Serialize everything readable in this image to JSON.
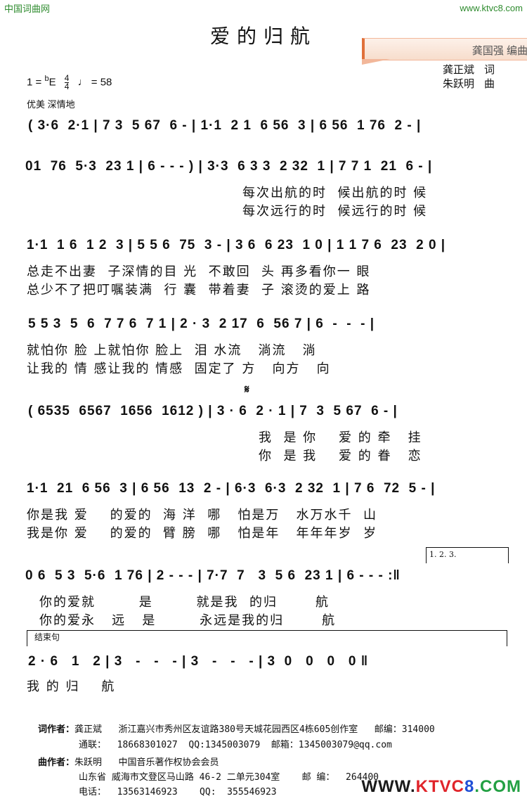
{
  "site": {
    "top_left": "中国词曲网",
    "top_right": "www.ktvc8.com"
  },
  "title": "爱的归航",
  "callout": "龚国强 编曲",
  "credits": [
    {
      "name": "龚正斌",
      "role": "词"
    },
    {
      "name": "朱跃明",
      "role": "曲"
    }
  ],
  "meta": {
    "key_prefix": "1 = ",
    "key_flat": "b",
    "key_note": "E",
    "time_numerator": "4",
    "time_denominator": "4",
    "tempo_note": "♩",
    "tempo": "= 58",
    "expression": "优美 深情地"
  },
  "systems": [
    {
      "notes": "( 3·6  2·1 | 7 3  5 67  6 - | 1·1  2 1  6 56  3 | 6 56  1 76  2 - |",
      "lyrics": []
    },
    {
      "notes": "01  76  5·3  23 1 | 6 - - - ) | 3·3  6 3 3  2 32  1 | 7 7 1  21  6 - |",
      "lyrics": [
        "每次出航的时  候出航的时 候",
        "每次远行的时  候远行的时 候"
      ]
    },
    {
      "notes": "1·1  1 6  1 2  3 | 5 5 6  75  3 - | 3 6  6 23  1 0 | 1 1 7 6  23  2 0 |",
      "lyrics": [
        "总走不出妻  子深情的目 光  不敢回  头 再多看你一 眼",
        "总少不了把叮嘱装满  行 囊  带着妻  子 滚烫的爱上 路"
      ]
    },
    {
      "notes": "5 5 3  5  6  7 7 6  7 1 | 2 · 3  2 17  6  56 7 | 6  -  -  - |",
      "lyrics": [
        "就怕你 脸 上就怕你 脸上  泪 水流   淌流   淌",
        "让我的 情 感让我的 情感  固定了 方   向方   向"
      ]
    },
    {
      "notes": "( 6535  6567  1656  1612 ) | 3 · 6  2 · 1 | 7  3  5 67  6 - |",
      "segno": "𝄋",
      "lyrics": [
        "我  是 你    爱 的 牵   挂",
        "你  是 我    爱 的 眷   恋"
      ]
    },
    {
      "notes": "1·1  21  6 56  3 | 6 56  13  2 - | 6·3  6·3  2 32  1 | 7 6  72  5 - |",
      "lyrics": [
        "你是我 爱    的爱的  海 洋  哪   怕是万   水万水千  山",
        "我是你 爱    的爱的  臂 膀  哪   怕是年   年年年岁  岁"
      ]
    },
    {
      "notes": "0 6  5 3  5·6  1 76 | 2 - - - | 7·7  7   3  5 6  23 1 | 6 - - - :‖",
      "volta": "1. 2. 3.",
      "lyrics": [
        "你的爱就        是        就是我  的归       航",
        "你的爱永   远   是        永远是我的归       航"
      ]
    },
    {
      "notes": "2 · 6   1   2 | 3   -   -   - | 3   -   -   - | 3  0   0   0   0 ‖",
      "coda_label": "结束句",
      "lyrics": [
        "我 的 归    航"
      ]
    }
  ],
  "footer": {
    "lyricist_label": "词作者：",
    "lyricist_line1": "龚正斌   浙江嘉兴市秀州区友谊路380号天城花园西区4栋605创作室   邮编：314000",
    "lyricist_line2": "通联：  18668301027  QQ:1345003079  邮箱：1345003079@qq.com",
    "composer_label": "曲作者：",
    "composer_line1": "朱跃明   中国音乐著作权协会会员",
    "composer_line2": "山东省 威海市文登区马山路 46-2 二单元304室    邮 编：  264400",
    "composer_line3": "电话：  13563146923    QQ:  355546923"
  },
  "watermark": {
    "w": "WWW.",
    "ktv": "KTVC",
    "eight": "8",
    "com": ".COM"
  }
}
